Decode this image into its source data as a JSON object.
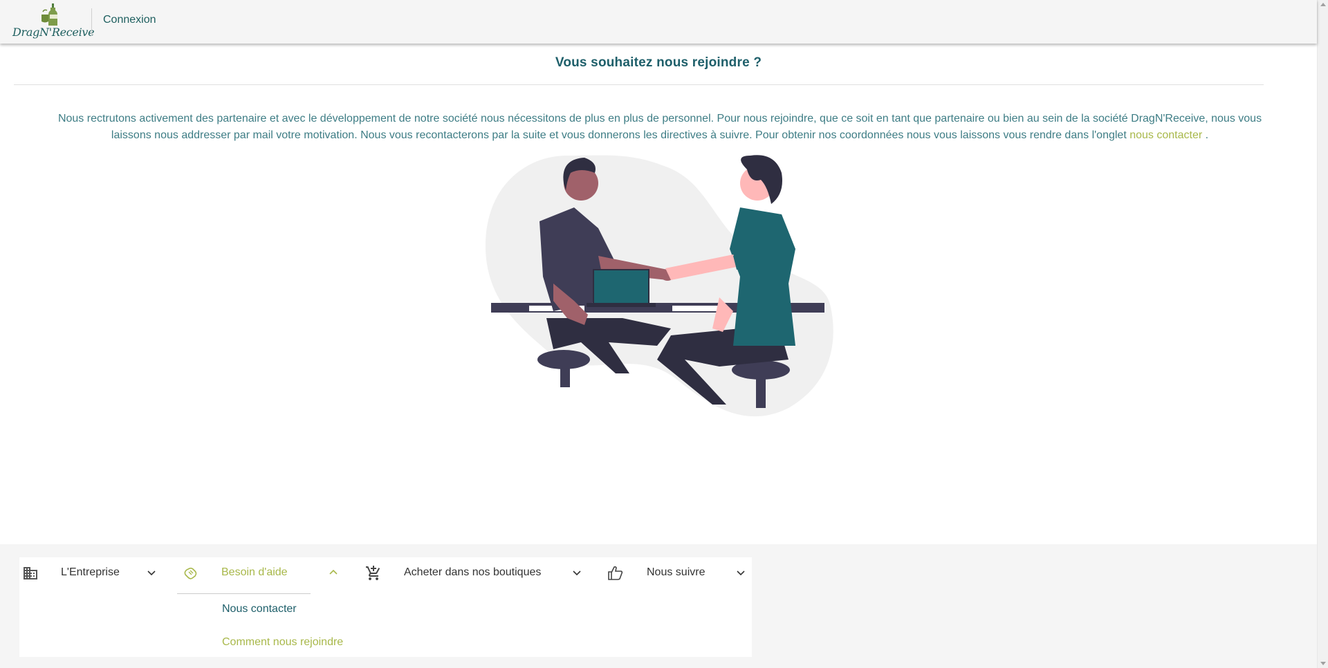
{
  "header": {
    "logo_text": "DragN'Receive",
    "login_label": "Connexion"
  },
  "main": {
    "title": "Vous souhaitez nous rejoindre ?",
    "paragraph_text": "Nous rectrutons activement des partenaire et avec le développement de notre société nous nécessitons de plus en plus de personnel. Pour nous rejoindre, que ce soit en tant que partenaire ou bien au sein de la société DragN'Receive, nous vous laissons nous addresser par mail votre motivation. Nous vous recontacterons par la suite et vous donnerons les directives à suivre. Pour obtenir nos coordonnées nous vous laissons vous rendre dans l'onglet",
    "paragraph_link": "nous contacter",
    "paragraph_end": " ."
  },
  "footer": {
    "menus": [
      {
        "label": "L'Entreprise",
        "icon": "building-icon",
        "expanded": false
      },
      {
        "label": "Besoin d'aide",
        "icon": "handshake-icon",
        "expanded": true
      },
      {
        "label": "Acheter dans nos boutiques",
        "icon": "cart-icon",
        "expanded": false
      },
      {
        "label": "Nous suivre",
        "icon": "thumbs-up-icon",
        "expanded": false
      }
    ],
    "submenu": {
      "items": [
        {
          "label": "Nous contacter",
          "active": false
        },
        {
          "label": "Comment nous rejoindre",
          "active": true
        }
      ]
    }
  },
  "colors": {
    "primary": "#1e5f6a",
    "text_teal": "#3e7d85",
    "accent": "#a8b84a",
    "header_bg": "#f5f5f5",
    "illustration_teal": "#1e6670",
    "illustration_dark": "#3f3d56",
    "illustration_skin_light": "#ffb8b8",
    "illustration_skin_dark": "#a0616a"
  }
}
